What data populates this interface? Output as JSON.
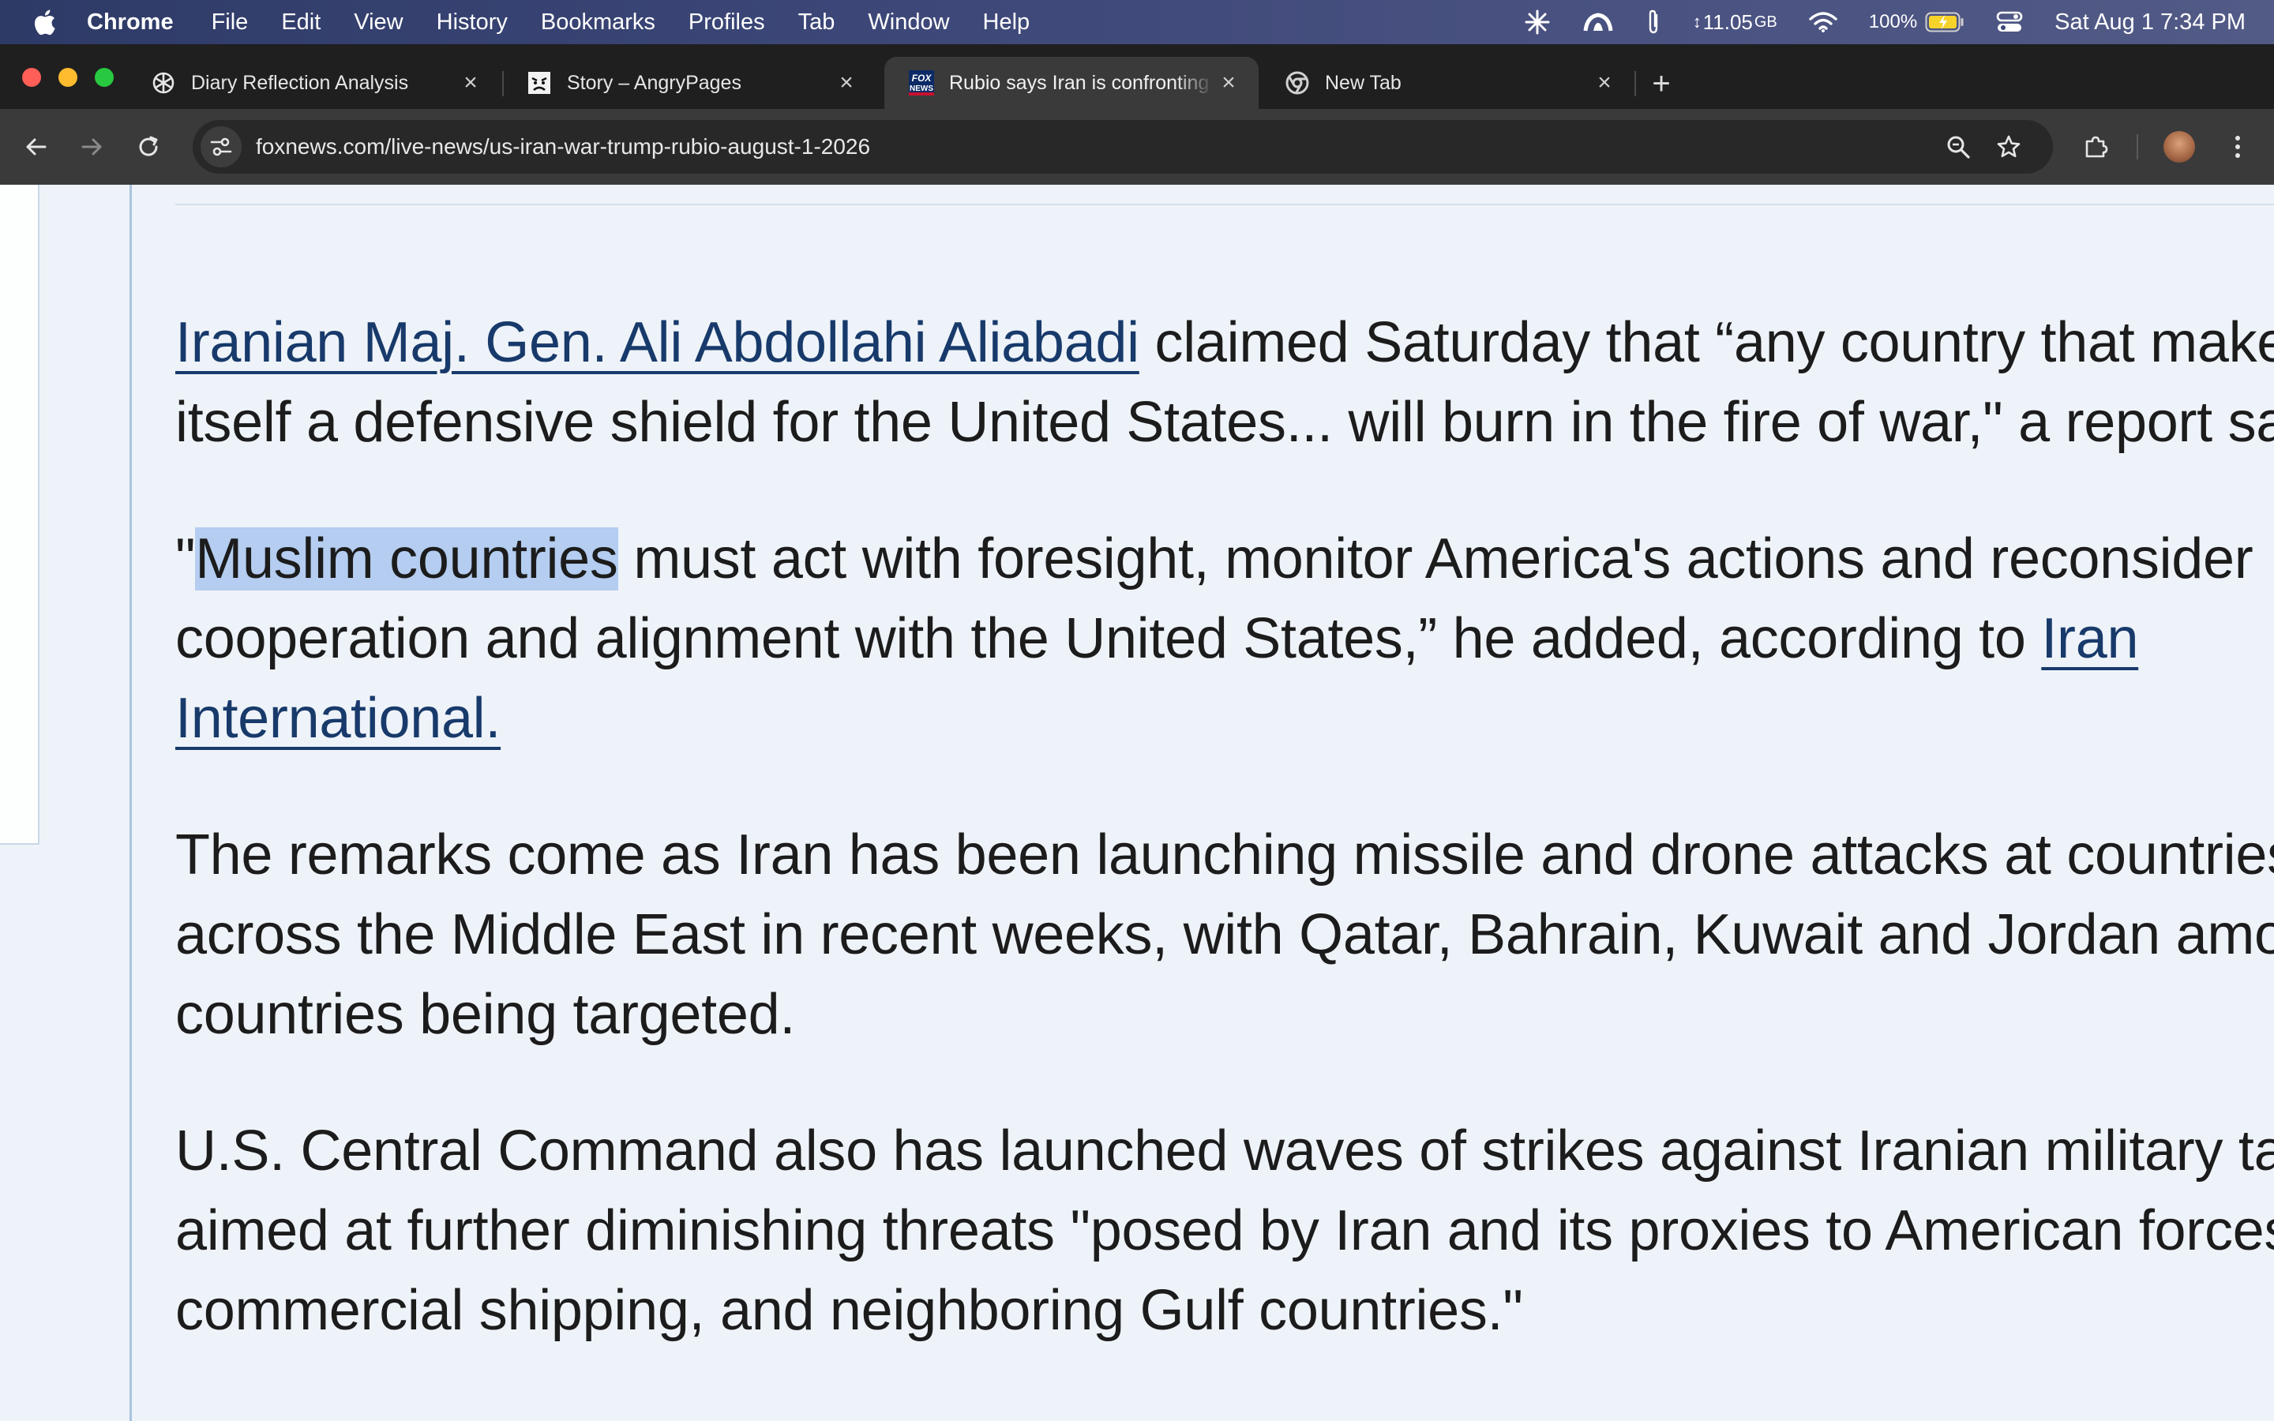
{
  "menubar": {
    "app_name": "Chrome",
    "menus": [
      "File",
      "Edit",
      "View",
      "History",
      "Bookmarks",
      "Profiles",
      "Tab",
      "Window",
      "Help"
    ],
    "memory": "11.05",
    "memory_unit": "GB",
    "battery_percent": "100%",
    "clock": "Sat Aug 1  7:34 PM"
  },
  "tabs": [
    {
      "title": "Diary Reflection Analysis",
      "icon": "openai-icon",
      "active": false
    },
    {
      "title": "Story – AngryPages",
      "icon": "angry-face-icon",
      "active": false
    },
    {
      "title": "Rubio says Iran is confronting",
      "icon": "fox-news-icon",
      "active": true
    },
    {
      "title": "New Tab",
      "icon": "chrome-icon",
      "active": false
    }
  ],
  "toolbar": {
    "url": "foxnews.com/live-news/us-iran-war-trump-rubio-august-1-2026"
  },
  "article": {
    "p1": {
      "link": "Iranian Maj. Gen. Ali Abdollahi Aliabadi",
      "line1_rest": " claimed Saturday that “any country that makes",
      "line2": "itself a defensive shield for the United States... will burn in the fire of war,\" a report said."
    },
    "p2": {
      "open_quote": "\"",
      "highlighted": "Muslim countries",
      "line1_rest": " must act with foresight, monitor America's actions and reconsider",
      "line2_text": "cooperation and alignment with the United States,” he added, according to ",
      "link_part1": "Iran",
      "link_part2": "International. "
    },
    "p3": {
      "line1": "The remarks come as Iran has been launching missile and drone attacks at countries",
      "line2": "across the Middle East in recent weeks, with Qatar, Bahrain, Kuwait and Jordan among the",
      "line3": "countries being targeted."
    },
    "p4": {
      "line1": "U.S. Central Command also has launched waves of strikes against Iranian military targets",
      "line2": "aimed at further diminishing threats \"posed by Iran and its proxies to American forces,",
      "line3": "commercial shipping, and neighboring Gulf countries.\""
    }
  }
}
